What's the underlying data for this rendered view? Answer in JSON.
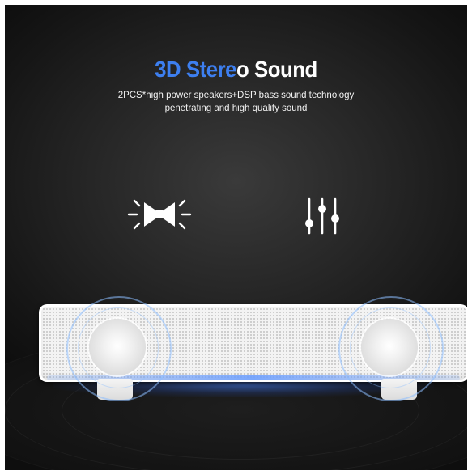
{
  "headline": {
    "highlight": "3D Stere",
    "rest": "o Sound"
  },
  "subtitle": {
    "line1": "2PCS*high power speakers+DSP bass sound technology",
    "line2": "penetrating and high quality sound"
  },
  "icons": [
    "speaker-pair-icon",
    "equalizer-icon"
  ],
  "colors": {
    "accent": "#3d7ff0",
    "background": "#1e1e1e",
    "speaker": "#f3f3f3"
  }
}
